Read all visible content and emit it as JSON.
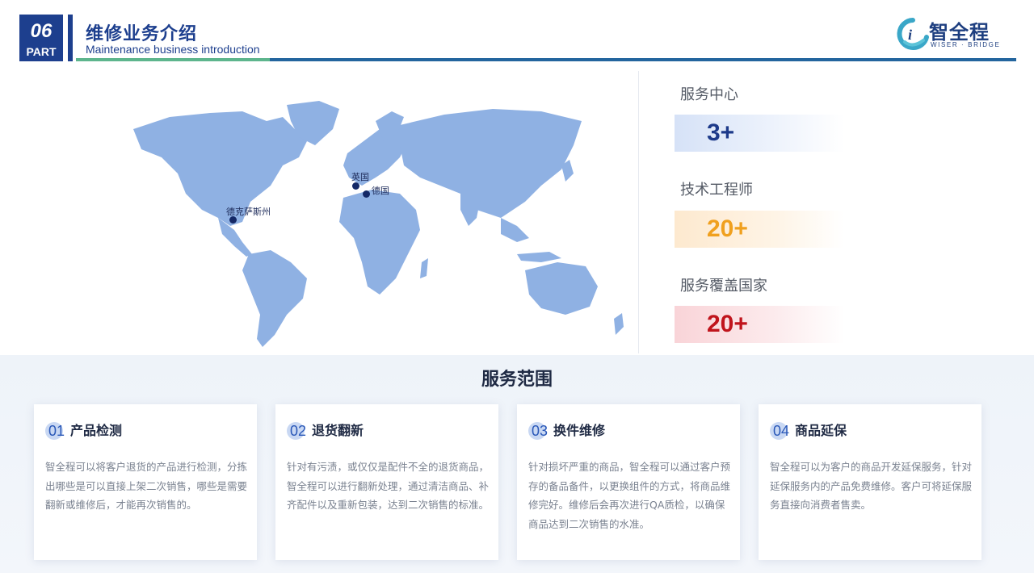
{
  "header": {
    "part_number": "06",
    "part_label": "PART",
    "title": "维修业务介绍",
    "subtitle": "Maintenance business introduction"
  },
  "logo": {
    "name": "智全程",
    "tagline": "WISER · BRIDGE"
  },
  "map": {
    "locations": [
      {
        "label": "英国"
      },
      {
        "label": "德国"
      },
      {
        "label": "德克萨斯州"
      }
    ]
  },
  "stats": [
    {
      "label": "服务中心",
      "value": "3+",
      "color": "#1d3a8a"
    },
    {
      "label": "技术工程师",
      "value": "20+",
      "color": "#f0a01e"
    },
    {
      "label": "服务覆盖国家",
      "value": "20+",
      "color": "#c0141c"
    }
  ],
  "services": {
    "title": "服务范围",
    "cards": [
      {
        "num": "01",
        "title": "产品检测",
        "desc": "智全程可以将客户退货的产品进行检测，分拣出哪些是可以直接上架二次销售，哪些是需要翻新或维修后，才能再次销售的。"
      },
      {
        "num": "02",
        "title": "退货翻新",
        "desc": "针对有污渍，或仅仅是配件不全的退货商品，智全程可以进行翻新处理，通过清洁商品、补齐配件以及重新包装，达到二次销售的标准。"
      },
      {
        "num": "03",
        "title": "换件维修",
        "desc": "针对损坏严重的商品，智全程可以通过客户预存的备品备件，以更换组件的方式，将商品维修完好。维修后会再次进行QA质检，以确保商品达到二次销售的水准。"
      },
      {
        "num": "04",
        "title": "商品延保",
        "desc": "智全程可以为客户的商品开发延保服务，针对延保服务内的产品免费维修。客户可将延保服务直接向消费者售卖。"
      }
    ]
  }
}
